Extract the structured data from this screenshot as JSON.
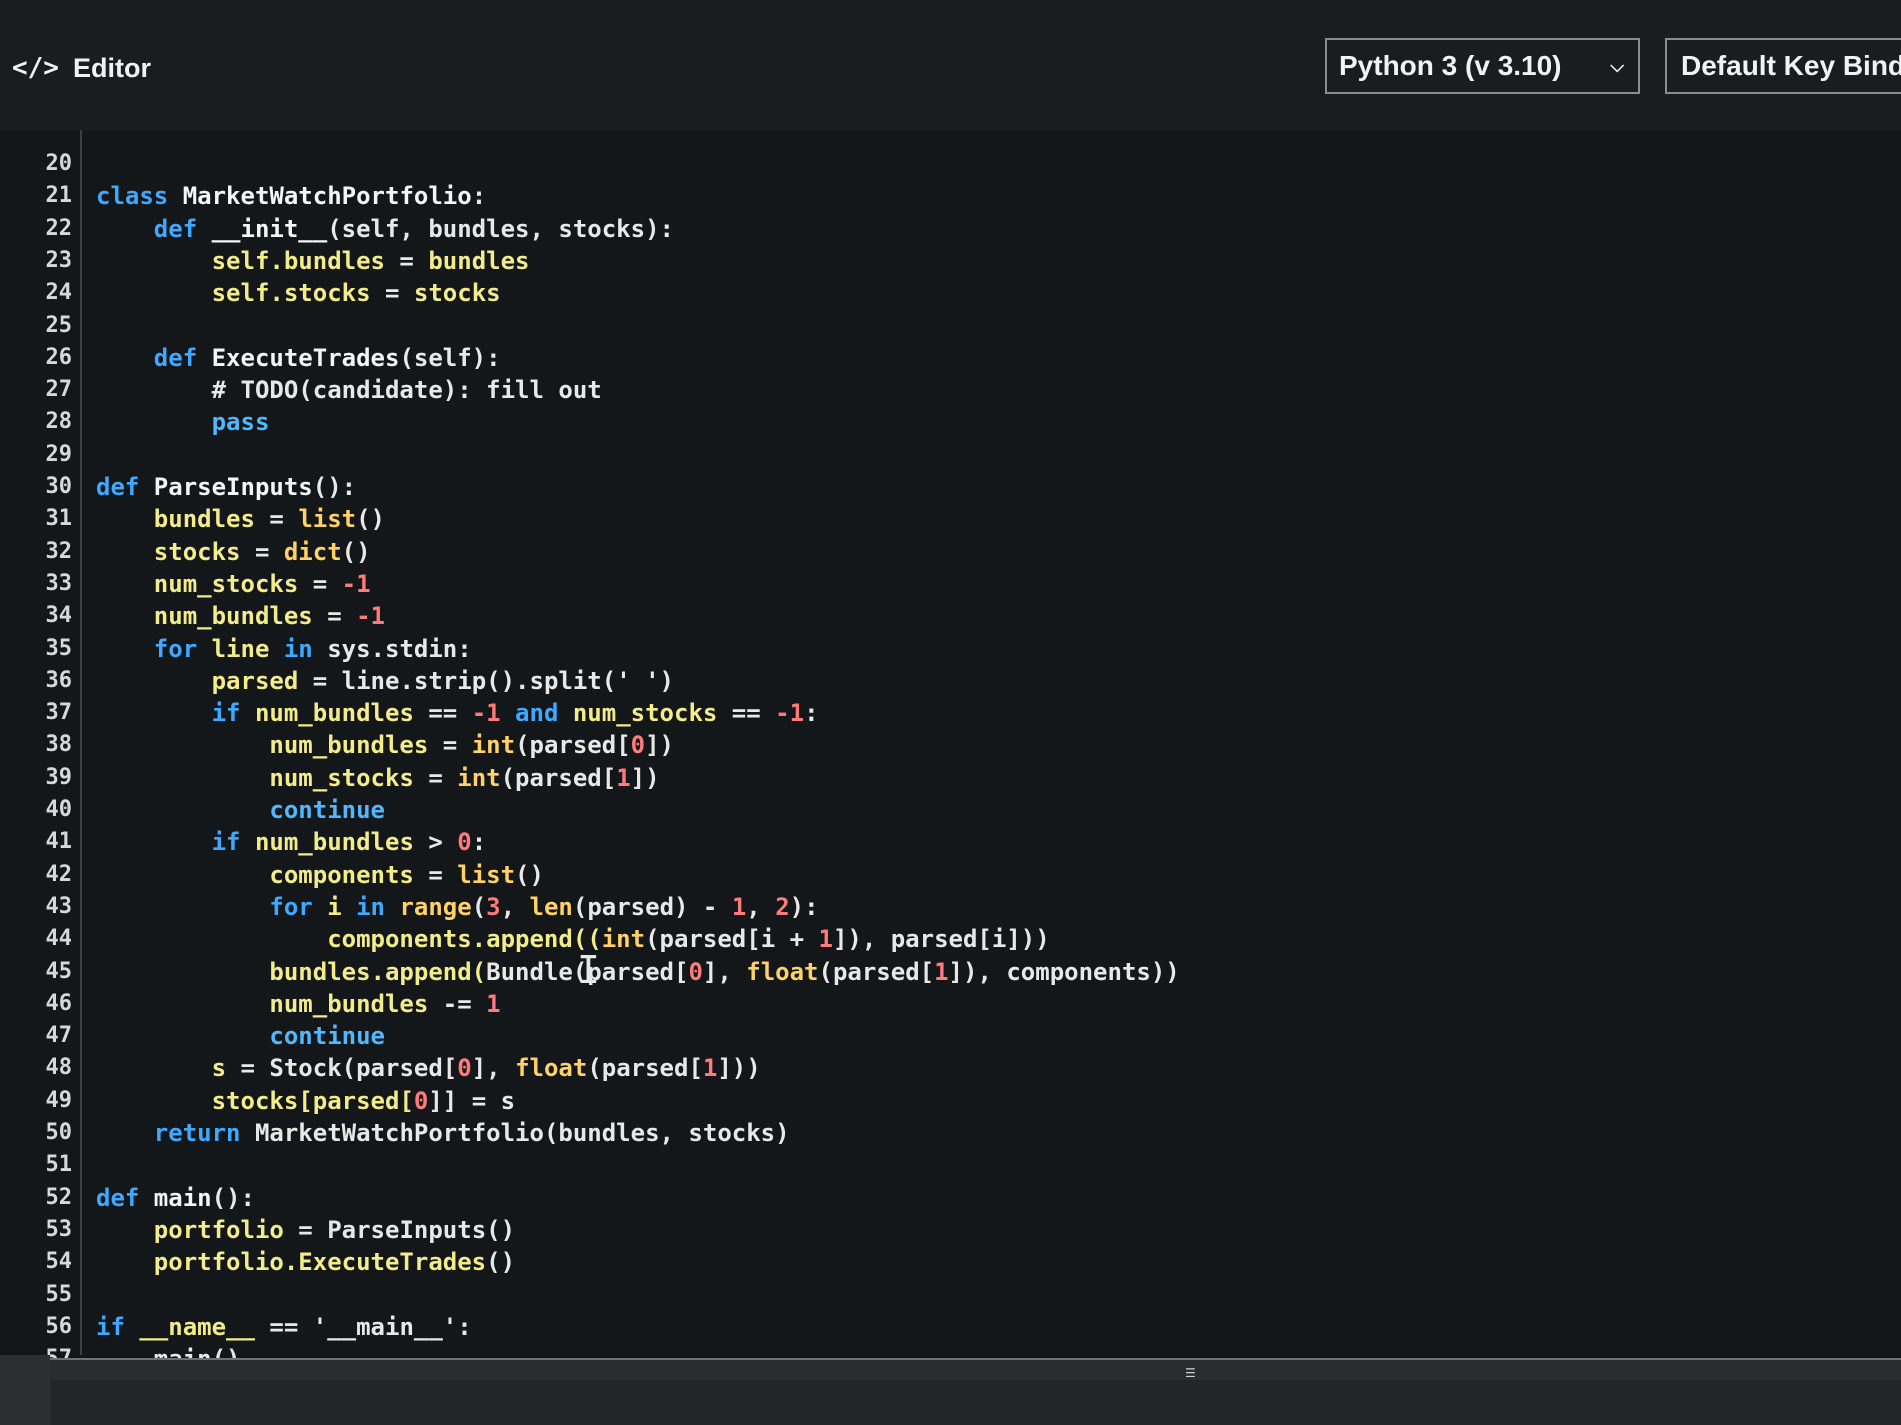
{
  "header": {
    "title": "Editor",
    "icon": "code-icon",
    "language_select": {
      "value": "Python 3 (v 3.10)",
      "icon": "chevron-down-icon"
    },
    "keybinding_label": "Default Key Bindin"
  },
  "editor": {
    "lines": [
      {
        "n": "20",
        "indent": 0,
        "t": [
          [
            "",
            "cm"
          ]
        ]
      },
      {
        "n": "21",
        "indent": 0,
        "t": [
          [
            "class ",
            "kw"
          ],
          [
            "MarketWatchPortfolio",
            "fn"
          ],
          [
            ":",
            "cm"
          ]
        ]
      },
      {
        "n": "22",
        "indent": 4,
        "t": [
          [
            "def ",
            "kw"
          ],
          [
            "__init__",
            "fn"
          ],
          [
            "(self, bundles, stocks):",
            "cm"
          ]
        ]
      },
      {
        "n": "23",
        "indent": 8,
        "t": [
          [
            "self.bundles",
            "yv"
          ],
          [
            " = ",
            "cm"
          ],
          [
            "bundles",
            "yv"
          ]
        ]
      },
      {
        "n": "24",
        "indent": 8,
        "t": [
          [
            "self.stocks",
            "yv"
          ],
          [
            " = ",
            "cm"
          ],
          [
            "stocks",
            "yv"
          ]
        ]
      },
      {
        "n": "25",
        "indent": 0,
        "t": [
          [
            "",
            "cm"
          ]
        ]
      },
      {
        "n": "26",
        "indent": 4,
        "t": [
          [
            "def ",
            "kw"
          ],
          [
            "ExecuteTrades",
            "fn"
          ],
          [
            "(self):",
            "cm"
          ]
        ]
      },
      {
        "n": "27",
        "indent": 8,
        "t": [
          [
            "# TODO(candidate): fill out",
            "cm"
          ]
        ]
      },
      {
        "n": "28",
        "indent": 8,
        "t": [
          [
            "pass",
            "kw2"
          ]
        ]
      },
      {
        "n": "29",
        "indent": 0,
        "t": [
          [
            "",
            "cm"
          ]
        ]
      },
      {
        "n": "30",
        "indent": 0,
        "t": [
          [
            "def ",
            "kw"
          ],
          [
            "ParseInputs",
            "fn"
          ],
          [
            "():",
            "cm"
          ]
        ]
      },
      {
        "n": "31",
        "indent": 4,
        "t": [
          [
            "bundles",
            "yv"
          ],
          [
            " = ",
            "cm"
          ],
          [
            "list",
            "bi"
          ],
          [
            "()",
            "cm"
          ]
        ]
      },
      {
        "n": "32",
        "indent": 4,
        "t": [
          [
            "stocks",
            "yv"
          ],
          [
            " = ",
            "cm"
          ],
          [
            "dict",
            "bi"
          ],
          [
            "()",
            "cm"
          ]
        ]
      },
      {
        "n": "33",
        "indent": 4,
        "t": [
          [
            "num_stocks",
            "yv"
          ],
          [
            " = ",
            "cm"
          ],
          [
            "-1",
            "num"
          ]
        ]
      },
      {
        "n": "34",
        "indent": 4,
        "t": [
          [
            "num_bundles",
            "yv"
          ],
          [
            " = ",
            "cm"
          ],
          [
            "-1",
            "num"
          ]
        ]
      },
      {
        "n": "35",
        "indent": 4,
        "t": [
          [
            "for ",
            "kw"
          ],
          [
            "line ",
            "yv"
          ],
          [
            "in ",
            "kw"
          ],
          [
            "sys.stdin:",
            "cm"
          ]
        ]
      },
      {
        "n": "36",
        "indent": 8,
        "t": [
          [
            "parsed",
            "yv"
          ],
          [
            " = ",
            "cm"
          ],
          [
            "line.strip().split(' ')",
            "cm"
          ]
        ]
      },
      {
        "n": "37",
        "indent": 8,
        "t": [
          [
            "if ",
            "kw"
          ],
          [
            "num_bundles",
            "yv"
          ],
          [
            " == ",
            "cm"
          ],
          [
            "-1",
            "num"
          ],
          [
            " and ",
            "kw"
          ],
          [
            "num_stocks",
            "yv"
          ],
          [
            " == ",
            "cm"
          ],
          [
            "-1",
            "num"
          ],
          [
            ":",
            "cm"
          ]
        ]
      },
      {
        "n": "38",
        "indent": 12,
        "t": [
          [
            "num_bundles",
            "yv"
          ],
          [
            " = ",
            "cm"
          ],
          [
            "int",
            "bi"
          ],
          [
            "(parsed[",
            "cm"
          ],
          [
            "0",
            "num"
          ],
          [
            "])",
            "cm"
          ]
        ]
      },
      {
        "n": "39",
        "indent": 12,
        "t": [
          [
            "num_stocks",
            "yv"
          ],
          [
            " = ",
            "cm"
          ],
          [
            "int",
            "bi"
          ],
          [
            "(parsed[",
            "cm"
          ],
          [
            "1",
            "num"
          ],
          [
            "])",
            "cm"
          ]
        ]
      },
      {
        "n": "40",
        "indent": 12,
        "t": [
          [
            "continue",
            "kw2"
          ]
        ]
      },
      {
        "n": "41",
        "indent": 8,
        "t": [
          [
            "if ",
            "kw"
          ],
          [
            "num_bundles",
            "yv"
          ],
          [
            " > ",
            "cm"
          ],
          [
            "0",
            "num"
          ],
          [
            ":",
            "cm"
          ]
        ]
      },
      {
        "n": "42",
        "indent": 12,
        "t": [
          [
            "components",
            "yv"
          ],
          [
            " = ",
            "cm"
          ],
          [
            "list",
            "bi"
          ],
          [
            "()",
            "cm"
          ]
        ]
      },
      {
        "n": "43",
        "indent": 12,
        "t": [
          [
            "for ",
            "kw"
          ],
          [
            "i ",
            "yv"
          ],
          [
            "in ",
            "kw"
          ],
          [
            "range",
            "bi"
          ],
          [
            "(",
            "cm"
          ],
          [
            "3",
            "num"
          ],
          [
            ", ",
            "cm"
          ],
          [
            "len",
            "bi"
          ],
          [
            "(parsed) - ",
            "cm"
          ],
          [
            "1",
            "num"
          ],
          [
            ", ",
            "cm"
          ],
          [
            "2",
            "num"
          ],
          [
            "):",
            "cm"
          ]
        ]
      },
      {
        "n": "44",
        "indent": 16,
        "t": [
          [
            "components.append((",
            "yv"
          ],
          [
            "int",
            "bi"
          ],
          [
            "(parsed[i + ",
            "cm"
          ],
          [
            "1",
            "num"
          ],
          [
            "]), parsed[i]))",
            "cm"
          ]
        ]
      },
      {
        "n": "45",
        "indent": 12,
        "t": [
          [
            "bundles.append(",
            "yv"
          ],
          [
            "Bundle(parsed[",
            "cm"
          ],
          [
            "0",
            "num"
          ],
          [
            "], ",
            "cm"
          ],
          [
            "float",
            "bi"
          ],
          [
            "(parsed[",
            "cm"
          ],
          [
            "1",
            "num"
          ],
          [
            "]), components))",
            "cm"
          ]
        ]
      },
      {
        "n": "46",
        "indent": 12,
        "t": [
          [
            "num_bundles",
            "yv"
          ],
          [
            " -= ",
            "cm"
          ],
          [
            "1",
            "num"
          ]
        ]
      },
      {
        "n": "47",
        "indent": 12,
        "t": [
          [
            "continue",
            "kw2"
          ]
        ]
      },
      {
        "n": "48",
        "indent": 8,
        "t": [
          [
            "s",
            "yv"
          ],
          [
            " = ",
            "cm"
          ],
          [
            "Stock(parsed[",
            "cm"
          ],
          [
            "0",
            "num"
          ],
          [
            "], ",
            "cm"
          ],
          [
            "float",
            "bi"
          ],
          [
            "(parsed[",
            "cm"
          ],
          [
            "1",
            "num"
          ],
          [
            "]))",
            "cm"
          ]
        ]
      },
      {
        "n": "49",
        "indent": 8,
        "t": [
          [
            "stocks[parsed[",
            "yv"
          ],
          [
            "0",
            "num"
          ],
          [
            "]] = s",
            "cm"
          ]
        ]
      },
      {
        "n": "50",
        "indent": 4,
        "t": [
          [
            "return ",
            "kw"
          ],
          [
            "MarketWatchPortfolio(bundles, stocks)",
            "cm"
          ]
        ]
      },
      {
        "n": "51",
        "indent": 0,
        "t": [
          [
            "",
            "cm"
          ]
        ]
      },
      {
        "n": "52",
        "indent": 0,
        "t": [
          [
            "def ",
            "kw"
          ],
          [
            "main",
            "fn"
          ],
          [
            "():",
            "cm"
          ]
        ]
      },
      {
        "n": "53",
        "indent": 4,
        "t": [
          [
            "portfolio",
            "yv"
          ],
          [
            " = ",
            "cm"
          ],
          [
            "ParseInputs()",
            "cm"
          ]
        ]
      },
      {
        "n": "54",
        "indent": 4,
        "t": [
          [
            "portfolio.ExecuteTrades",
            "yv"
          ],
          [
            "()",
            "cm"
          ]
        ]
      },
      {
        "n": "55",
        "indent": 0,
        "t": [
          [
            "",
            "cm"
          ]
        ]
      },
      {
        "n": "56",
        "indent": 0,
        "t": [
          [
            "if ",
            "kw"
          ],
          [
            "__name__",
            "yv"
          ],
          [
            " == ",
            "cm"
          ],
          [
            "'__main__'",
            "cm"
          ],
          [
            ":",
            "cm"
          ]
        ]
      },
      {
        "n": "57",
        "indent": 4,
        "t": [
          [
            "main()",
            "cm"
          ]
        ]
      }
    ]
  },
  "cursor_glyph": "I"
}
